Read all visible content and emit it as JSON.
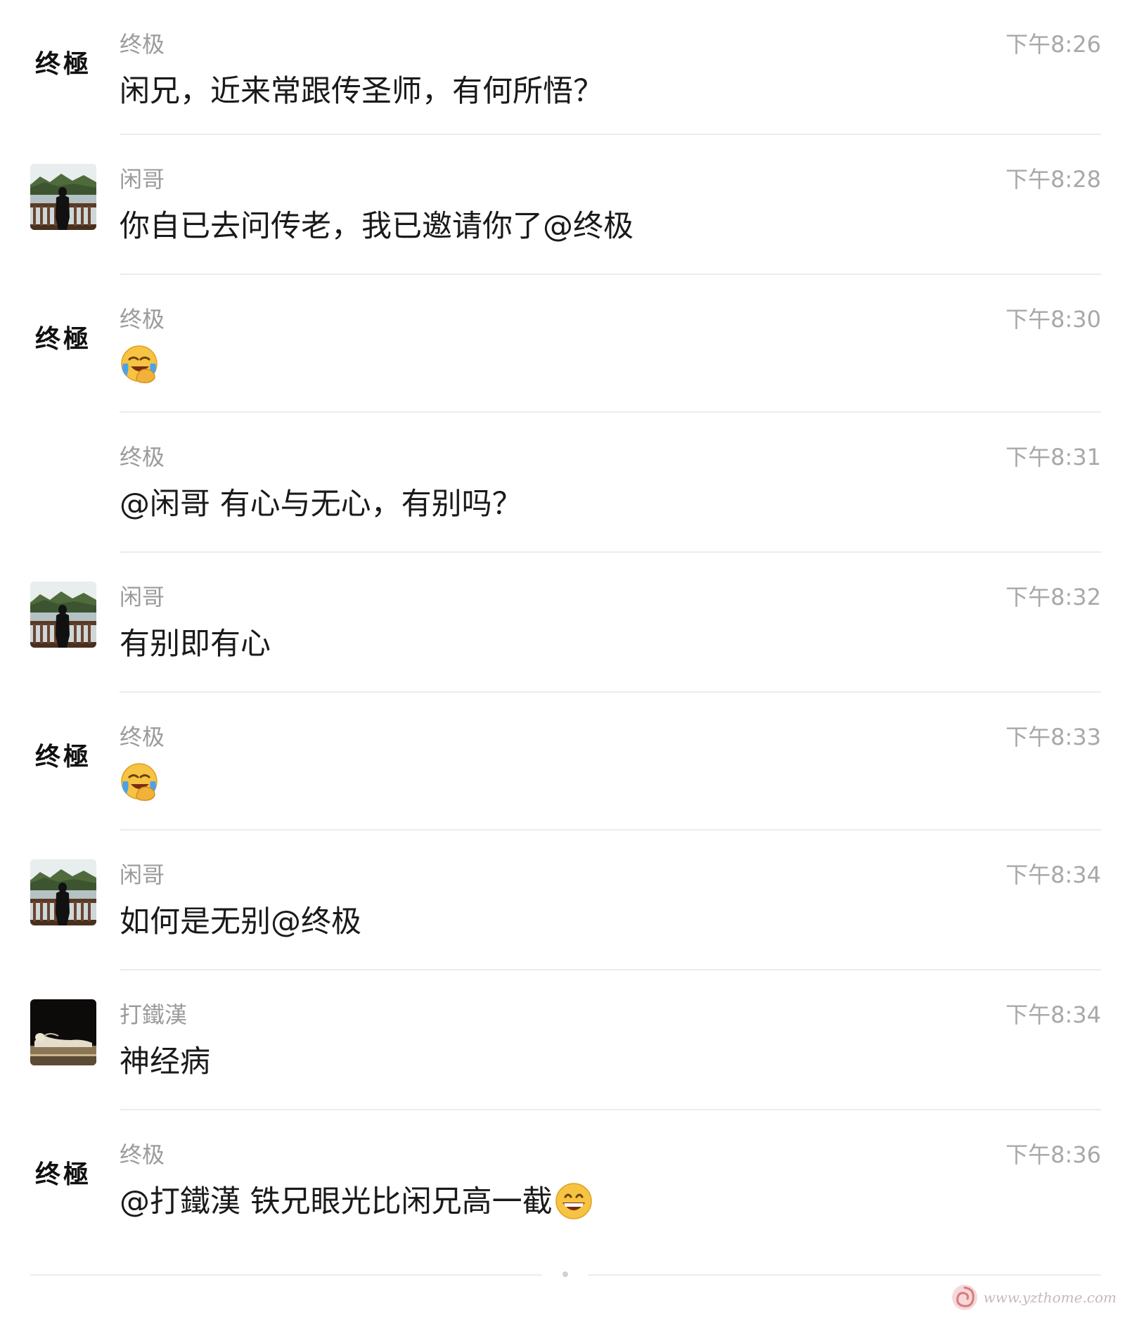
{
  "messages": [
    {
      "sender": "终极",
      "time": "下午8:26",
      "text": "闲兄，近来常跟传圣师，有何所悟？",
      "avatar": "终極"
    },
    {
      "sender": "闲哥",
      "time": "下午8:28",
      "text": "你自已去问传老，我已邀请你了@终极",
      "avatar": "lake-silhouette"
    },
    {
      "sender": "终极",
      "time": "下午8:30",
      "emoji": "face-with-hand-crying-laughing-icon",
      "avatar": "终極"
    },
    {
      "sender": "终极",
      "time": "下午8:31",
      "text": "@闲哥 有心与无心，有别吗？"
    },
    {
      "sender": "闲哥",
      "time": "下午8:32",
      "text": "有别即有心",
      "avatar": "lake-silhouette"
    },
    {
      "sender": "终极",
      "time": "下午8:33",
      "emoji": "face-with-hand-crying-laughing-icon",
      "avatar": "终極"
    },
    {
      "sender": "闲哥",
      "time": "下午8:34",
      "text": "如何是无别@终极",
      "avatar": "lake-silhouette"
    },
    {
      "sender": "打鐵漢",
      "time": "下午8:34",
      "text": "神经病",
      "avatar": "reclining-buddha"
    },
    {
      "sender": "终极",
      "time": "下午8:36",
      "text": "@打鐵漢 铁兄眼光比闲兄高一截",
      "trailing_emoji": "grinning-face-icon",
      "avatar": "终極"
    }
  ],
  "watermark": {
    "text": "www.yzthome.com"
  },
  "colors": {
    "name": "#9b9b9b",
    "time": "#a8a8a8",
    "text": "#1a1a1a",
    "divider": "#ececec"
  }
}
